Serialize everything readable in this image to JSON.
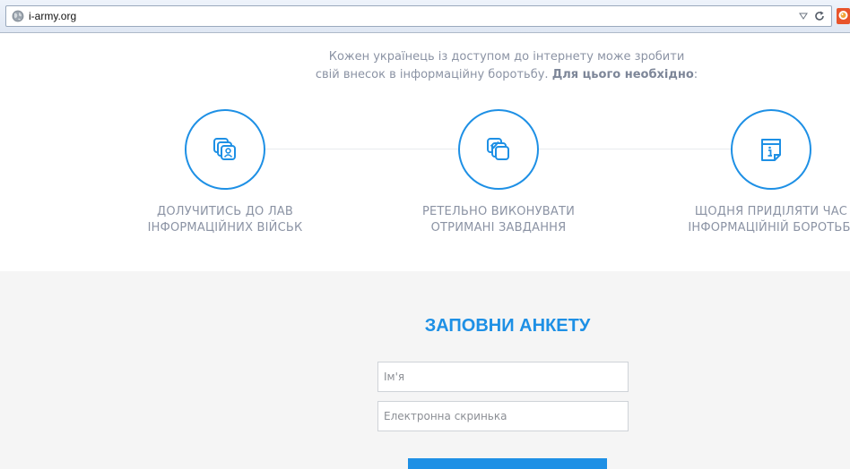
{
  "browser": {
    "url": "i-army.org",
    "icons": [
      "globe-icon",
      "dropdown-icon",
      "reload-icon",
      "extension-icon"
    ]
  },
  "intro": {
    "line1": "Кожен українець із доступом до інтернету може зробити",
    "line2_plain": "свій внесок в інформаційну боротьбу. ",
    "line2_bold": "Для цього необхідно",
    "line2_end": ":"
  },
  "steps": [
    {
      "icon": "users-icon",
      "line1": "Долучитись до лав",
      "line2": "інформаційних військ"
    },
    {
      "icon": "tasks-check-icon",
      "line1": "Ретельно виконувати",
      "line2": "отримані завдання"
    },
    {
      "icon": "info-document-icon",
      "line1": "Щодня приділяти час",
      "line2": "інформаційній боротьбі"
    }
  ],
  "form": {
    "title": "ЗАПОВНИ АНКЕТУ",
    "name_placeholder": "Ім'я",
    "email_placeholder": "Електронна скринька"
  },
  "colors": {
    "accent": "#1e90e5",
    "text_muted": "#8b93a4",
    "form_bg": "#f5f5f5"
  }
}
